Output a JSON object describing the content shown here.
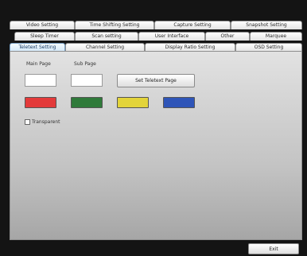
{
  "tabs": {
    "row1": [
      "Video Setting",
      "Time Shifting Setting",
      "Capture Setting",
      "Snapshot Setting"
    ],
    "row2": [
      "Sleep Timer",
      "Scan setting",
      "User Interface",
      "Other",
      "Marquee"
    ],
    "row3": [
      "Teletext Setting",
      "Channel Setting",
      "Display Ratio Setting",
      "OSD Setting"
    ],
    "active": "Teletext Setting"
  },
  "teletext": {
    "main_page_label": "Main Page",
    "sub_page_label": "Sub Page",
    "main_page_value": "",
    "sub_page_value": "",
    "set_button_label": "Set Teletext Page",
    "color_buttons": [
      {
        "name": "red",
        "color": "#e33a3a"
      },
      {
        "name": "green",
        "color": "#2f7a3a"
      },
      {
        "name": "yellow",
        "color": "#e3d43a"
      },
      {
        "name": "blue",
        "color": "#2f55b8"
      }
    ],
    "transparent_label": "Transparent",
    "transparent_checked": false
  },
  "footer": {
    "exit_label": "Exit"
  }
}
